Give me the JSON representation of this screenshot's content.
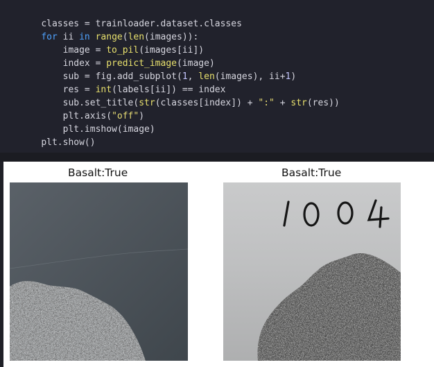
{
  "code": {
    "lines": [
      {
        "text": "classes = trainloader.dataset.classes"
      },
      {
        "text": "for ii in range(len(images)):"
      },
      {
        "text": "    image = to_pil(images[ii])"
      },
      {
        "text": "    index = predict_image(image)"
      },
      {
        "text": "    sub = fig.add_subplot(1, len(images), ii+1)"
      },
      {
        "text": "    res = int(labels[ii]) == index"
      },
      {
        "text": "    sub.set_title(str(classes[index]) + \":\" + str(res))"
      },
      {
        "text": "    plt.axis(\"off\")"
      },
      {
        "text": "    plt.imshow(image)"
      },
      {
        "text": "plt.show()"
      }
    ]
  },
  "output": {
    "subplots": [
      {
        "title": "Basalt:True"
      },
      {
        "title": "Basalt:True",
        "handwritten": "1004"
      }
    ]
  }
}
